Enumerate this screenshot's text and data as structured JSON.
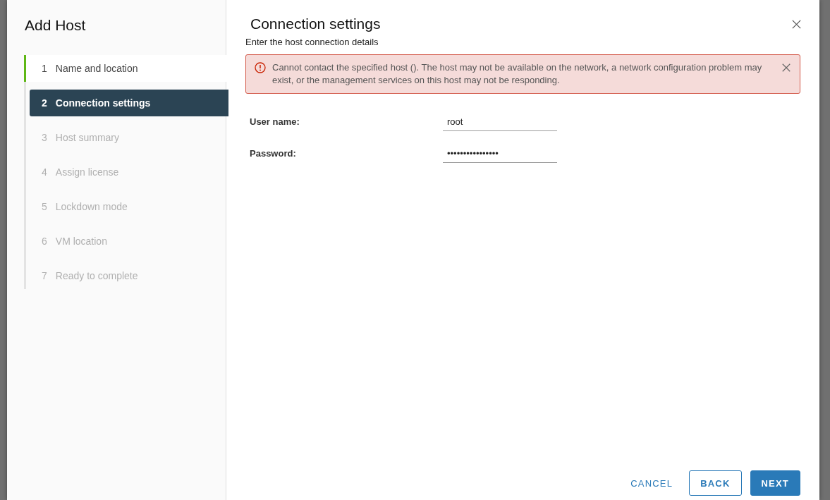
{
  "dialog": {
    "title": "Add Host"
  },
  "steps": [
    {
      "number": "1",
      "label": "Name and location",
      "selected": false,
      "completed": true
    },
    {
      "number": "2",
      "label": "Connection settings",
      "selected": true,
      "completed": false
    },
    {
      "number": "3",
      "label": "Host summary",
      "selected": false,
      "completed": false
    },
    {
      "number": "4",
      "label": "Assign license",
      "selected": false,
      "completed": false
    },
    {
      "number": "5",
      "label": "Lockdown mode",
      "selected": false,
      "completed": false
    },
    {
      "number": "6",
      "label": "VM location",
      "selected": false,
      "completed": false
    },
    {
      "number": "7",
      "label": "Ready to complete",
      "selected": false,
      "completed": false
    }
  ],
  "page": {
    "title": "Connection settings",
    "subtitle": "Enter the host connection details"
  },
  "alert": {
    "kind": "error",
    "message": "Cannot contact the specified host (). The host may not be available on the network, a network configuration problem may exist, or the management services on this host may not be responding."
  },
  "fields": [
    {
      "label": "User name:",
      "value": "root"
    },
    {
      "label": "Password:",
      "value": "••••••••••••••••"
    }
  ],
  "buttons": [
    {
      "label": "CANCEL",
      "kind": "flat"
    },
    {
      "label": "BACK",
      "kind": "outline"
    },
    {
      "label": "NEXT",
      "kind": "primary"
    }
  ]
}
